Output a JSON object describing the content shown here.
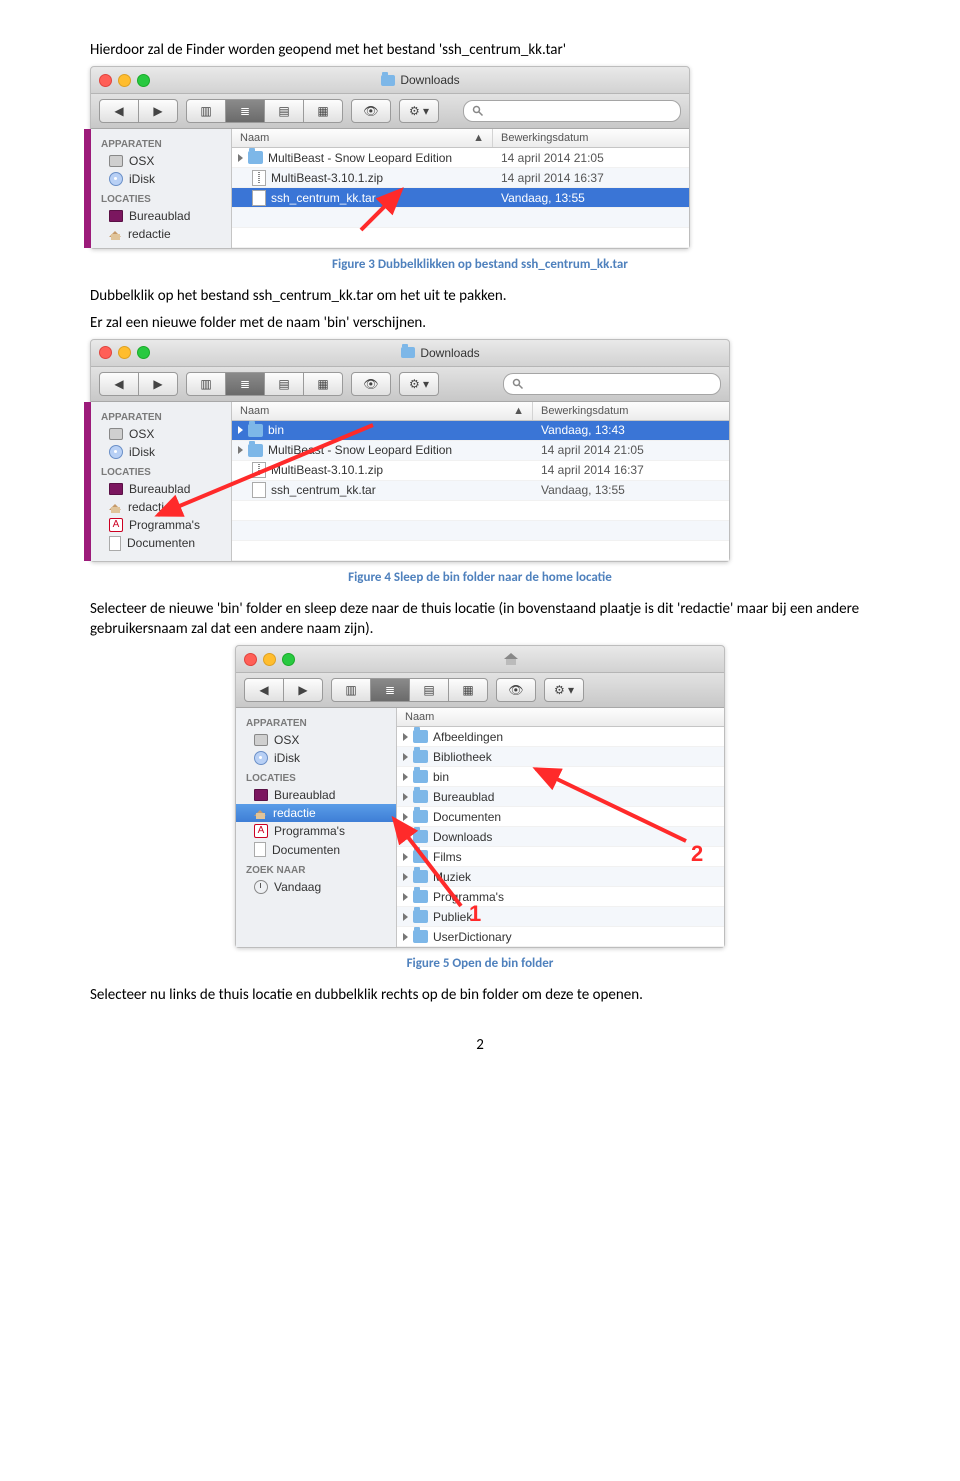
{
  "para1": "Hierdoor zal de Finder worden geopend met het bestand 'ssh_centrum_kk.tar'",
  "caption3": "Figure 3 Dubbelklikken op bestand ssh_centrum_kk.tar",
  "para2a": "Dubbelklik op het bestand ssh_centrum_kk.tar om het uit te pakken.",
  "para2b": "Er zal een nieuwe folder met de naam 'bin' verschijnen.",
  "caption4": "Figure 4 Sleep de bin folder naar de home locatie",
  "para3": "Selecteer de nieuwe 'bin' folder en sleep deze naar de thuis locatie (in bovenstaand plaatje is dit 'redactie' maar bij een andere gebruikersnaam zal dat een andere naam zijn).",
  "caption5": "Figure 5 Open de bin folder",
  "para4": "Selecteer nu links de thuis locatie en dubbelklik rechts op de bin folder om deze te openen.",
  "page_num": "2",
  "common": {
    "searchPlaceholder": "Q",
    "col_name": "Naam",
    "col_date": "Bewerkingsdatum",
    "sb_devices": "APPARATEN",
    "sb_places": "LOCATIES",
    "sb_search": "ZOEK NAAR"
  },
  "fig1": {
    "title": "Downloads",
    "sidebar": {
      "devices": [
        {
          "label": "OSX",
          "icon": "hd"
        },
        {
          "label": "iDisk",
          "icon": "disk"
        }
      ],
      "places": [
        {
          "label": "Bureaublad",
          "icon": "desk"
        },
        {
          "label": "redactie",
          "icon": "home"
        }
      ]
    },
    "rows": [
      {
        "name": "MultiBeast - Snow Leopard Edition",
        "date": "14 april 2014 21:05",
        "type": "folder",
        "tri": true
      },
      {
        "name": "MultiBeast-3.10.1.zip",
        "date": "14 april 2014 16:37",
        "type": "zip"
      },
      {
        "name": "ssh_centrum_kk.tar",
        "date": "Vandaag, 13:55",
        "type": "tar",
        "sel": true
      }
    ]
  },
  "fig2": {
    "title": "Downloads",
    "sidebar": {
      "devices": [
        {
          "label": "OSX",
          "icon": "hd"
        },
        {
          "label": "iDisk",
          "icon": "disk"
        }
      ],
      "places": [
        {
          "label": "Bureaublad",
          "icon": "desk"
        },
        {
          "label": "redactie",
          "icon": "home"
        },
        {
          "label": "Programma's",
          "icon": "app"
        },
        {
          "label": "Documenten",
          "icon": "doc"
        }
      ]
    },
    "rows": [
      {
        "name": "bin",
        "date": "Vandaag, 13:43",
        "type": "folder",
        "tri": true,
        "sel": true
      },
      {
        "name": "MultiBeast - Snow Leopard Edition",
        "date": "14 april 2014 21:05",
        "type": "folder",
        "tri": true
      },
      {
        "name": "MultiBeast-3.10.1.zip",
        "date": "14 april 2014 16:37",
        "type": "zip"
      },
      {
        "name": "ssh_centrum_kk.tar",
        "date": "Vandaag, 13:55",
        "type": "tar"
      }
    ]
  },
  "fig3": {
    "title": "",
    "sidebar": {
      "devices": [
        {
          "label": "OSX",
          "icon": "hd"
        },
        {
          "label": "iDisk",
          "icon": "disk"
        }
      ],
      "places": [
        {
          "label": "Bureaublad",
          "icon": "desk"
        },
        {
          "label": "redactie",
          "icon": "home",
          "sel": true
        },
        {
          "label": "Programma's",
          "icon": "app"
        },
        {
          "label": "Documenten",
          "icon": "doc"
        }
      ],
      "search": [
        {
          "label": "Vandaag",
          "icon": "clock"
        }
      ]
    },
    "col_name": "Naam",
    "rows": [
      {
        "name": "Afbeeldingen"
      },
      {
        "name": "Bibliotheek"
      },
      {
        "name": "bin"
      },
      {
        "name": "Bureaublad"
      },
      {
        "name": "Documenten"
      },
      {
        "name": "Downloads"
      },
      {
        "name": "Films"
      },
      {
        "name": "Muziek"
      },
      {
        "name": "Programma's"
      },
      {
        "name": "Publiek"
      },
      {
        "name": "UserDictionary"
      }
    ],
    "annot1": "1",
    "annot2": "2"
  }
}
